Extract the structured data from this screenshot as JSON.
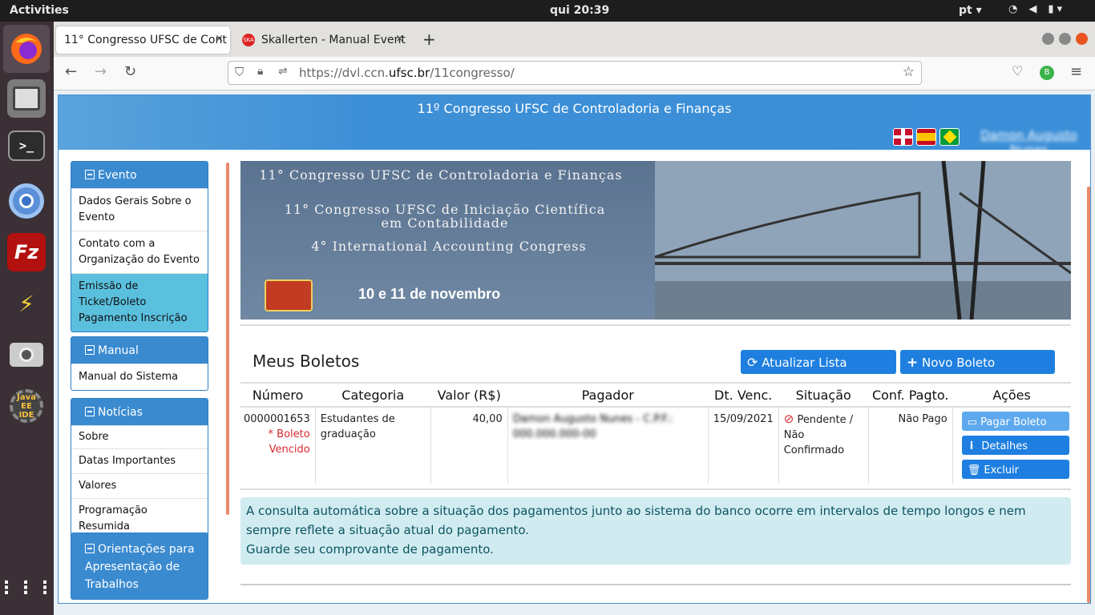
{
  "os": {
    "activities": "Activities",
    "clock": "qui 20:39",
    "lang": "pt ▾"
  },
  "dock": {
    "items": [
      "firefox",
      "files",
      "terminal",
      "chromium",
      "filezilla",
      "remote-desktop",
      "camera",
      "java-ee-ide",
      "apps-grid"
    ],
    "java_label": "Java EE IDE"
  },
  "tabs": [
    {
      "title": "11° Congresso UFSC de Cont",
      "close": "×"
    },
    {
      "title": "Skallerten - Manual Event",
      "close": "×"
    }
  ],
  "newtab": "+",
  "url": {
    "prefix": "https://dvl.ccn.",
    "domain": "ufsc.br",
    "path": "/11congresso/"
  },
  "page": {
    "header_title": "11º Congresso UFSC de Controladoria e Finanças",
    "user_link": "Damon Augusto Nunes"
  },
  "sidebar": [
    {
      "heading": "Evento",
      "items": [
        "Dados Gerais Sobre o Evento",
        "Contato com a Organização do Evento",
        "Emissão de Ticket/Boleto Pagamento Inscrição"
      ]
    },
    {
      "heading": "Manual",
      "items": [
        "Manual do Sistema"
      ]
    },
    {
      "heading": "Notícias",
      "items": [
        "Sobre",
        "Datas Importantes",
        "Valores",
        "Programação Resumida"
      ]
    },
    {
      "heading": "Orientações para Apresentação de Trabalhos",
      "items": []
    }
  ],
  "banner": {
    "line1": "11° Congresso UFSC de Controladoria e Finanças",
    "line2": "11° Congresso UFSC de Iniciação Científica em Contabilidade",
    "line3": "4° International Accounting Congress",
    "date": "10 e 11 de novembro"
  },
  "boletos": {
    "title": "Meus Boletos",
    "refresh_label": "Atualizar Lista",
    "new_label": "Novo Boleto",
    "columns": [
      "Número",
      "Categoria",
      "Valor (R$)",
      "Pagador",
      "Dt. Venc.",
      "Situação",
      "Conf. Pagto.",
      "Ações"
    ],
    "row": {
      "numero": "0000001653",
      "vencido": "* Boleto Vencido",
      "categoria": "Estudantes de graduação",
      "valor": "40,00",
      "pagador": "Damon Augusto Nunes - C.P.F.: 000.000.000-00",
      "vencimento": "15/09/2021",
      "situacao": "Pendente / Não Confirmado",
      "conf": "Não Pago",
      "acoes": {
        "pagar": "Pagar Boleto",
        "detalhes": "Detalhes",
        "excluir": "Excluir"
      }
    },
    "notice_line1": "A consulta automática sobre a situação dos pagamentos junto ao sistema do banco ocorre em intervalos de tempo longos e nem sempre reflete a situação atual do pagamento.",
    "notice_line2": "Guarde seu comprovante de pagamento."
  }
}
